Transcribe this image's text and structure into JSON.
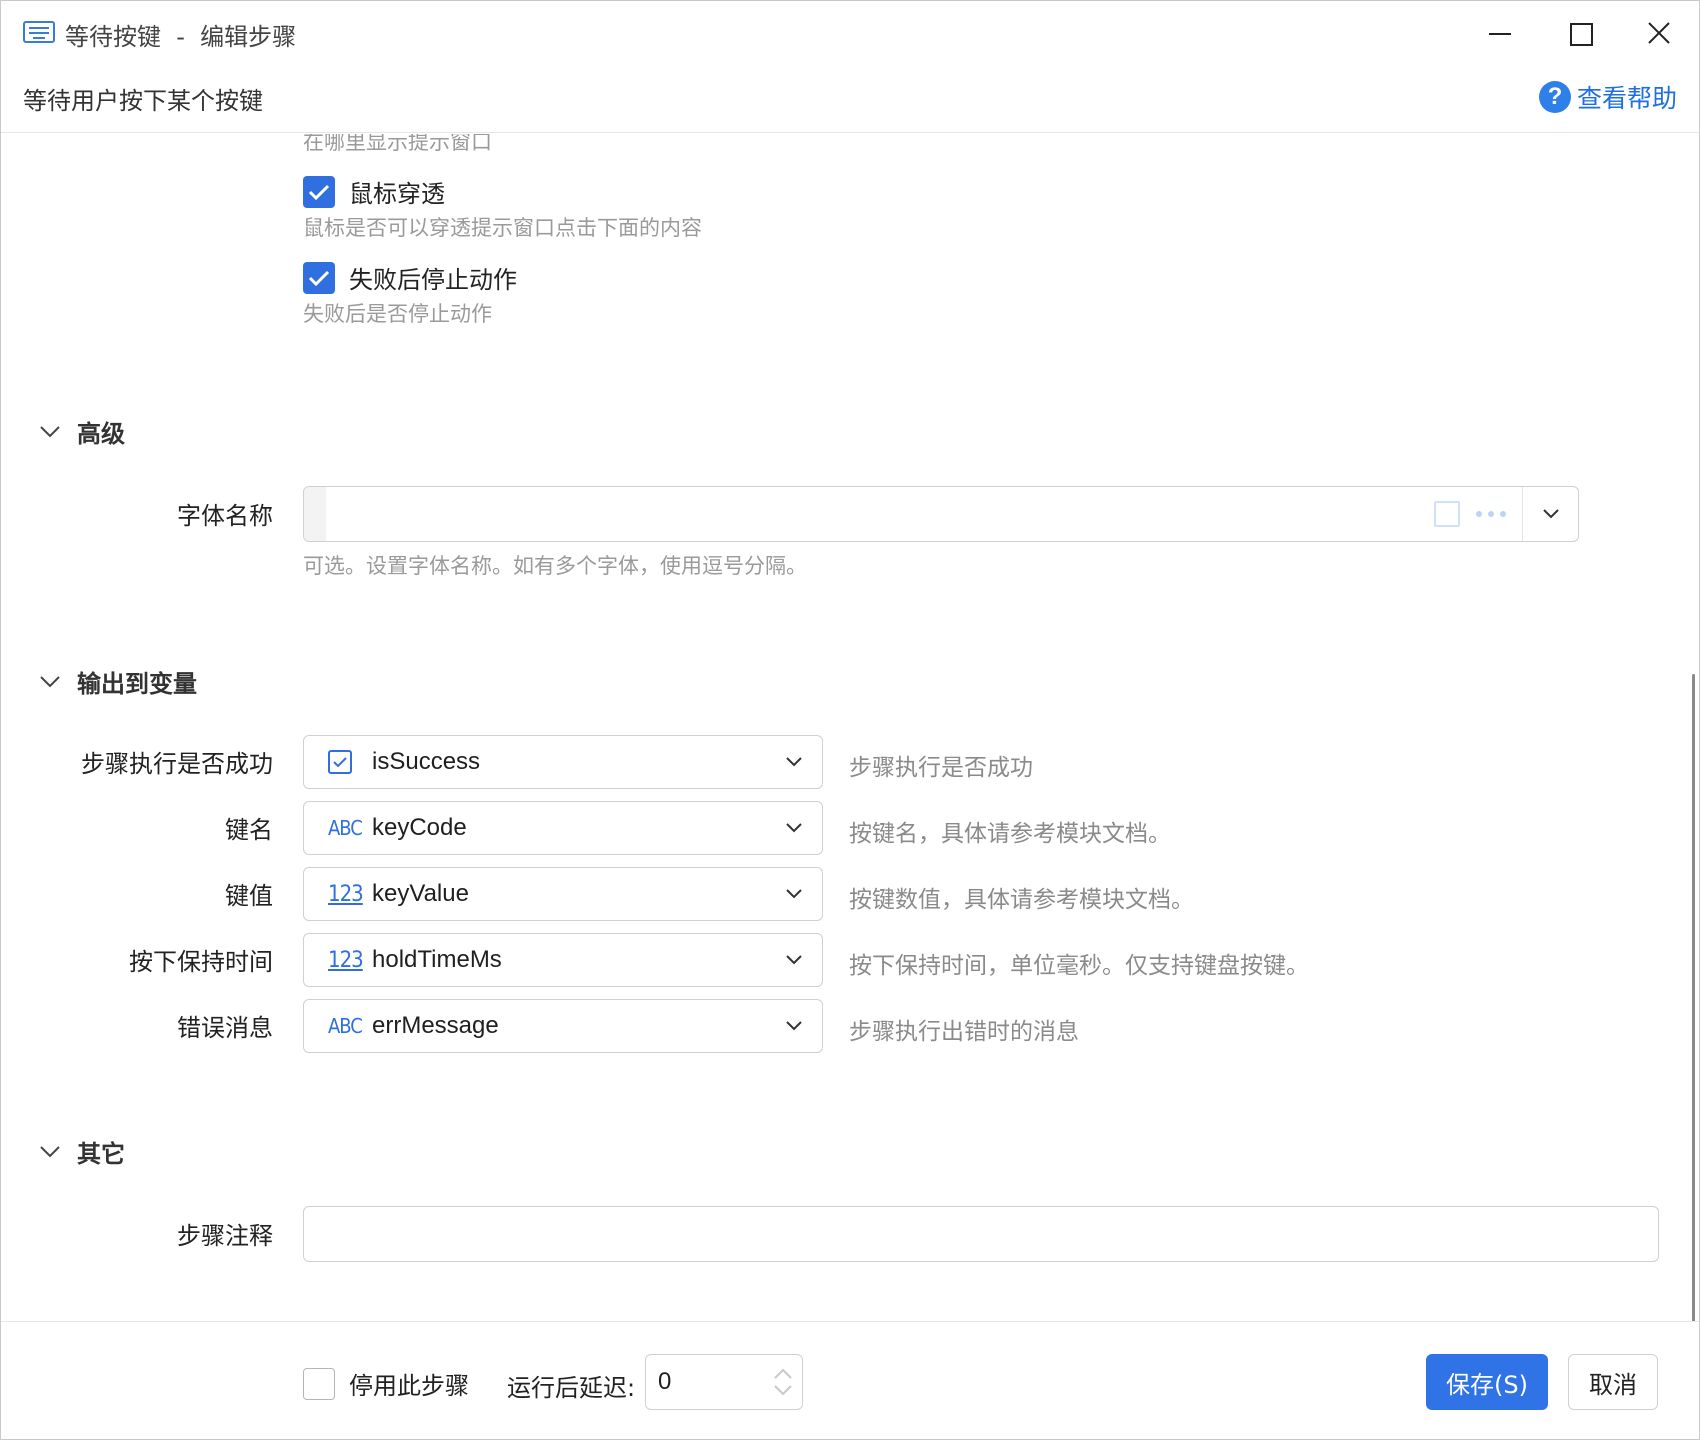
{
  "window": {
    "title": "等待按键  -  编辑步骤",
    "subtitle": "等待用户按下某个按键",
    "help_label": "查看帮助"
  },
  "options": {
    "cutoff_hint": "在哪里显示提示窗口",
    "mouse_passthrough": {
      "label": "鼠标穿透",
      "hint": "鼠标是否可以穿透提示窗口点击下面的内容",
      "checked": true
    },
    "stop_on_fail": {
      "label": "失败后停止动作",
      "hint": "失败后是否停止动作",
      "checked": true
    }
  },
  "advanced": {
    "section_title": "高级",
    "font_name": {
      "label": "字体名称",
      "value": "",
      "hint": "可选。设置字体名称。如有多个字体，使用逗号分隔。"
    }
  },
  "output": {
    "section_title": "输出到变量",
    "rows": [
      {
        "label": "步骤执行是否成功",
        "type_icon": "checkbox-icon",
        "variable": "isSuccess",
        "desc": "步骤执行是否成功"
      },
      {
        "label": "键名",
        "type_icon": "ABC",
        "variable": "keyCode",
        "desc": "按键名，具体请参考模块文档。"
      },
      {
        "label": "键值",
        "type_icon": "123",
        "variable": "keyValue",
        "desc": "按键数值，具体请参考模块文档。"
      },
      {
        "label": "按下保持时间",
        "type_icon": "123",
        "variable": "holdTimeMs",
        "desc": "按下保持时间，单位毫秒。仅支持键盘按键。"
      },
      {
        "label": "错误消息",
        "type_icon": "ABC",
        "variable": "errMessage",
        "desc": "步骤执行出错时的消息"
      }
    ]
  },
  "other": {
    "section_title": "其它",
    "comment": {
      "label": "步骤注释",
      "value": ""
    }
  },
  "footer": {
    "disable_label": "停用此步骤",
    "disable_checked": false,
    "delay_label": "运行后延迟:",
    "delay_value": "0",
    "save_label": "保存(S)",
    "cancel_label": "取消"
  },
  "colors": {
    "accent": "#2f73e6",
    "hint": "#9a9a9a"
  }
}
